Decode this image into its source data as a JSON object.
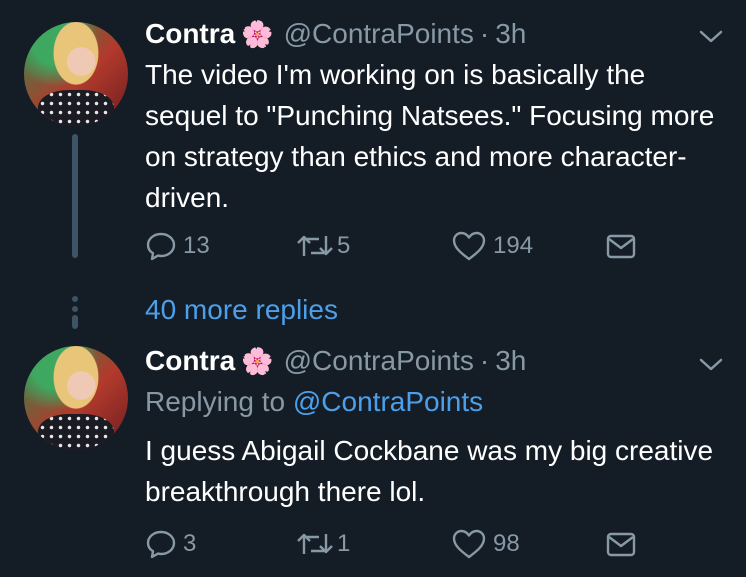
{
  "tweets": [
    {
      "name": "Contra",
      "flower": "🌸",
      "handle": "@ContraPoints",
      "separator": "·",
      "time": "3h",
      "text": "The video I'm working on is basically the sequel to \"Punching Natsees.\" Focusing more on strategy than ethics and more character-driven.",
      "replies": "13",
      "retweets": "5",
      "likes": "194"
    },
    {
      "name": "Contra",
      "flower": "🌸",
      "handle": "@ContraPoints",
      "separator": "·",
      "time": "3h",
      "replying_prefix": "Replying to",
      "replying_to": "@ContraPoints",
      "text": "I guess Abigail Cockbane was my big creative breakthrough there lol.",
      "replies": "3",
      "retweets": "1",
      "likes": "98"
    }
  ],
  "more_replies": "40 more replies",
  "icons": {
    "reply": "reply-icon",
    "retweet": "retweet-icon",
    "like": "heart-icon",
    "dm": "envelope-icon",
    "menu": "chevron-down-icon"
  },
  "colors": {
    "background": "#141d26",
    "muted": "#8899a6",
    "link": "#4ca0eb"
  }
}
